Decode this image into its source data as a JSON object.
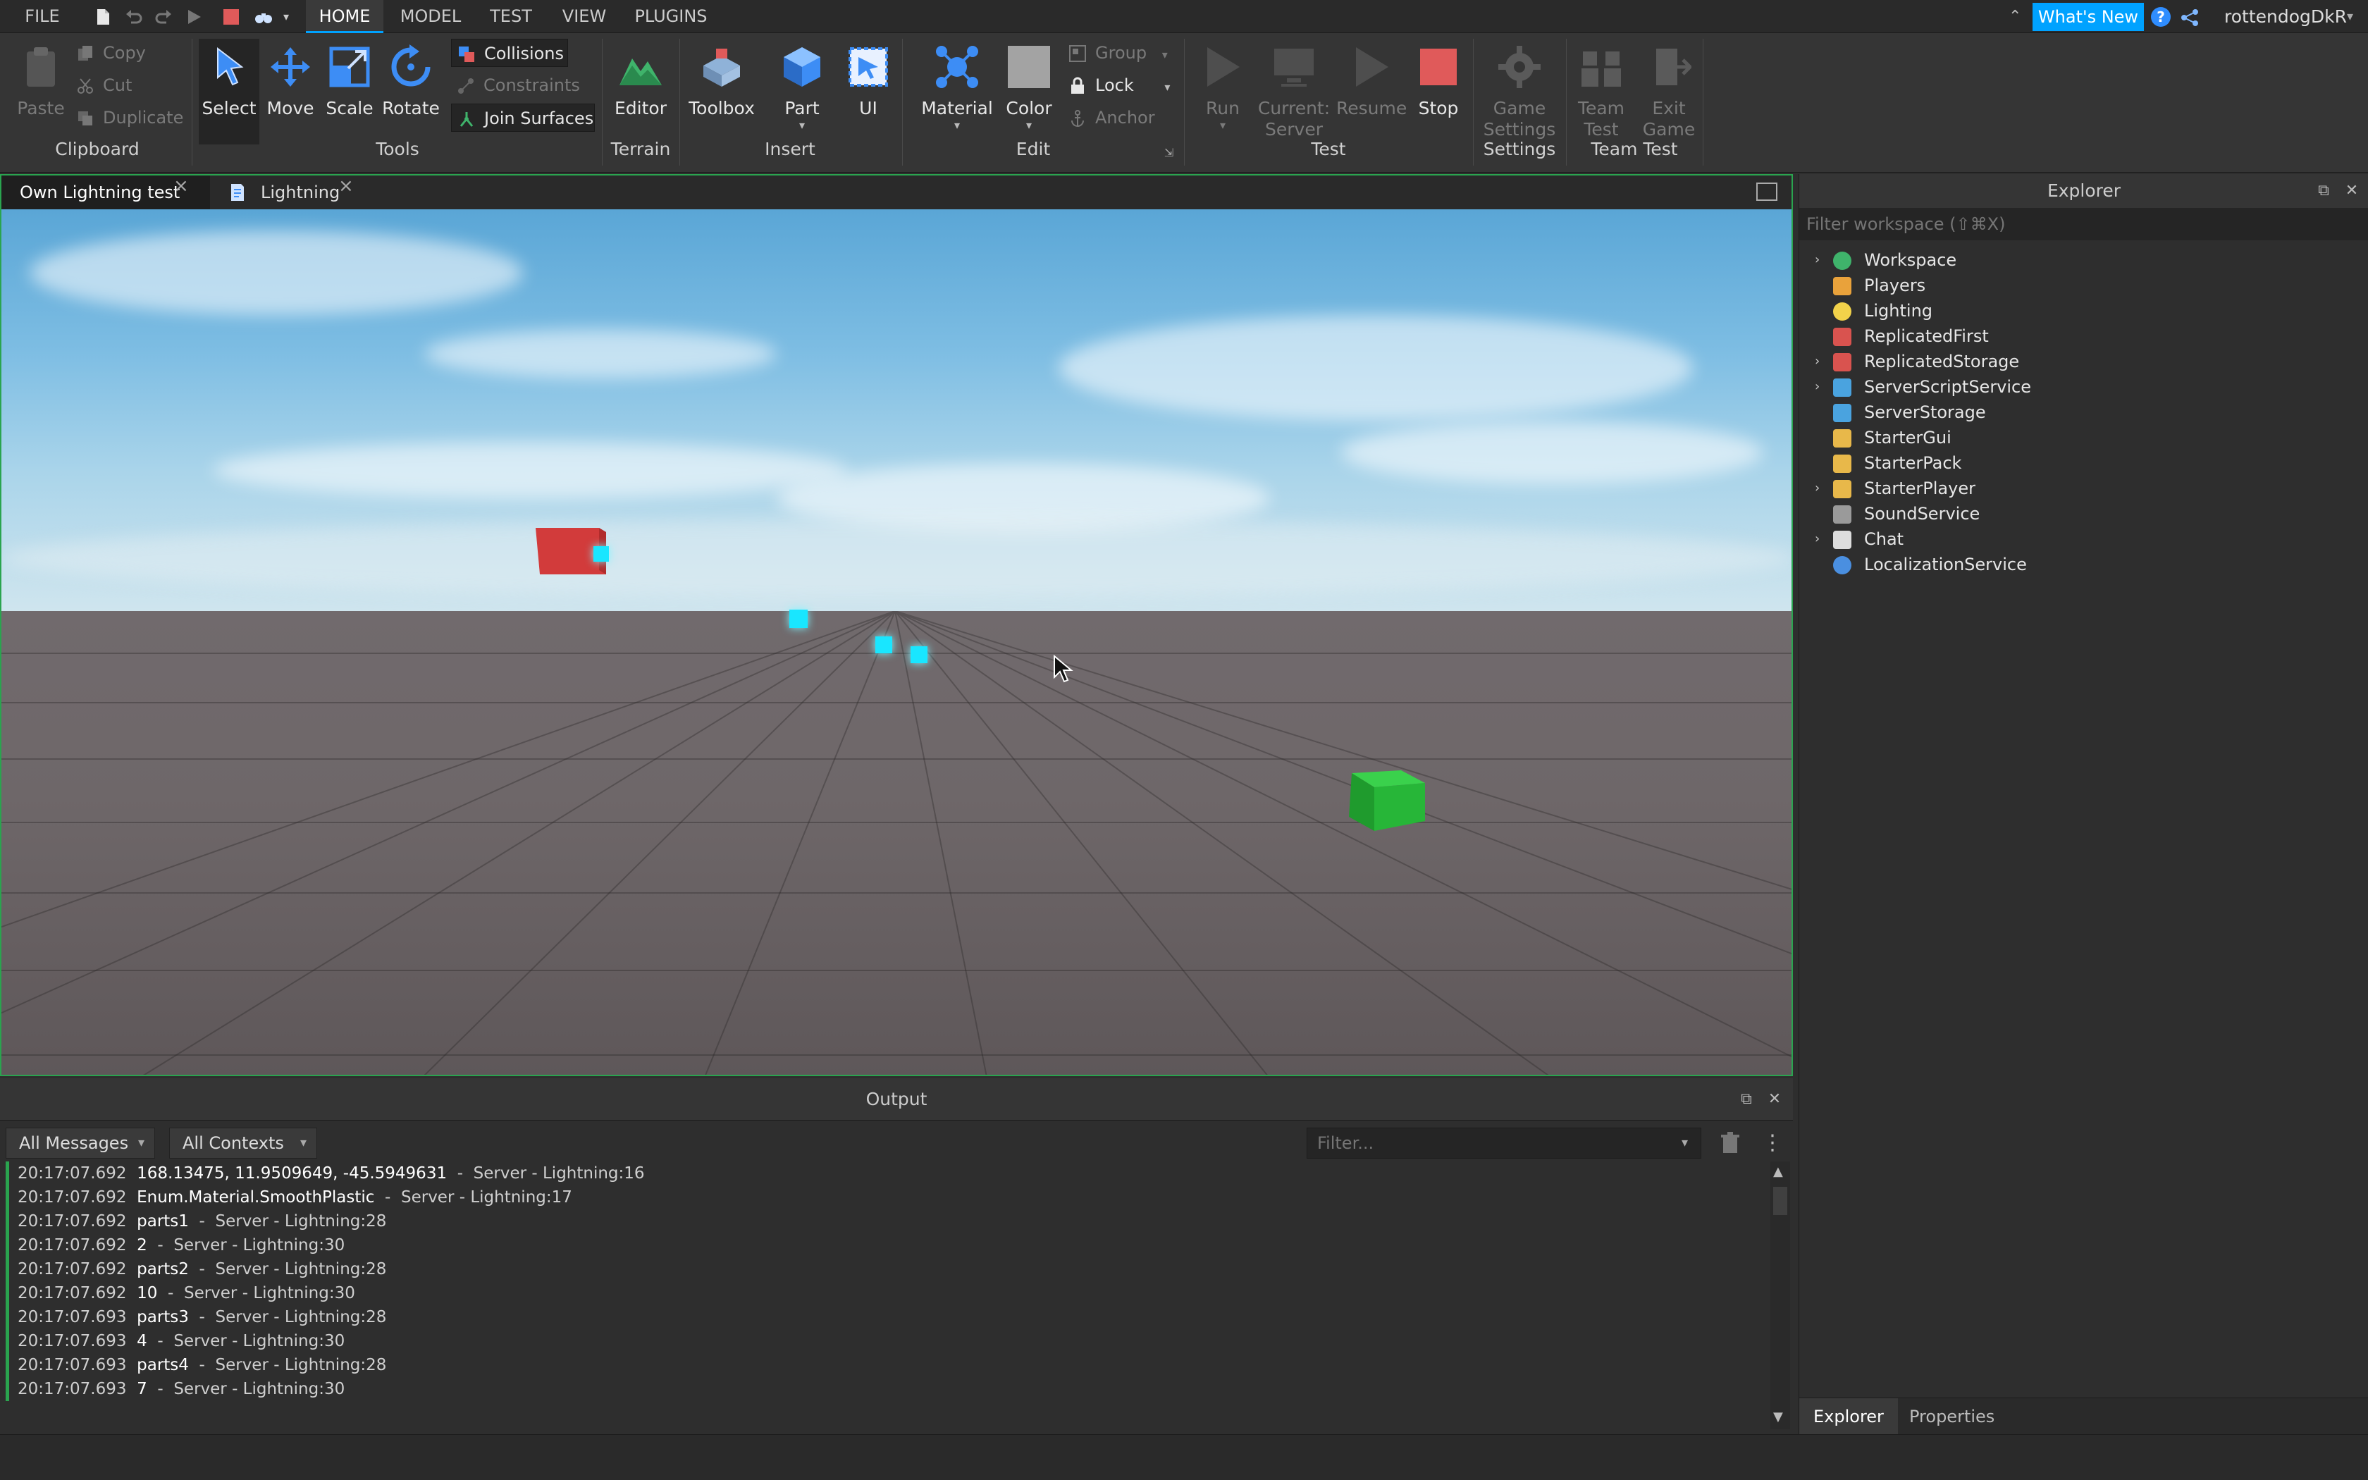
{
  "menubar": {
    "file": "FILE",
    "tabs": [
      {
        "label": "HOME",
        "active": true
      },
      {
        "label": "MODEL",
        "active": false
      },
      {
        "label": "TEST",
        "active": false
      },
      {
        "label": "VIEW",
        "active": false
      },
      {
        "label": "PLUGINS",
        "active": false
      }
    ],
    "whats_new": "What's New",
    "username": "rottendogDkR"
  },
  "ribbon": {
    "clipboard": {
      "group": "Clipboard",
      "paste": "Paste",
      "copy": "Copy",
      "cut": "Cut",
      "duplicate": "Duplicate"
    },
    "tools": {
      "group": "Tools",
      "select": "Select",
      "move": "Move",
      "scale": "Scale",
      "rotate": "Rotate",
      "collisions": "Collisions",
      "constraints": "Constraints",
      "join_surfaces": "Join Surfaces"
    },
    "terrain": {
      "group": "Terrain",
      "editor": "Editor"
    },
    "insert": {
      "group": "Insert",
      "toolbox": "Toolbox",
      "part": "Part",
      "ui": "UI"
    },
    "edit": {
      "group": "Edit",
      "material": "Material",
      "color": "Color",
      "group_btn": "Group",
      "lock": "Lock",
      "anchor": "Anchor"
    },
    "test": {
      "group": "Test",
      "run": "Run",
      "current_line1": "Current:",
      "current_line2": "Server",
      "resume": "Resume",
      "stop": "Stop"
    },
    "settings": {
      "group": "Settings",
      "line1": "Game",
      "line2": "Settings"
    },
    "team_test": {
      "group": "Team Test",
      "team_line1": "Team",
      "team_line2": "Test",
      "exit_line1": "Exit",
      "exit_line2": "Game"
    }
  },
  "doc_tabs": [
    {
      "label": "Own Lightning test",
      "active": true
    },
    {
      "label": "Lightning",
      "active": false
    }
  ],
  "output": {
    "title": "Output",
    "messages_filter": "All Messages",
    "contexts_filter": "All Contexts",
    "filter_placeholder": "Filter...",
    "lines": [
      {
        "ts": "20:17:07.692",
        "msg": "168.13475, 11.9509649, -45.5949631",
        "src": "Server - Lightning:16"
      },
      {
        "ts": "20:17:07.692",
        "msg": "Enum.Material.SmoothPlastic",
        "src": "Server - Lightning:17"
      },
      {
        "ts": "20:17:07.692",
        "msg": "parts1",
        "src": "Server - Lightning:28"
      },
      {
        "ts": "20:17:07.692",
        "msg": "2",
        "src": "Server - Lightning:30"
      },
      {
        "ts": "20:17:07.692",
        "msg": "parts2",
        "src": "Server - Lightning:28"
      },
      {
        "ts": "20:17:07.692",
        "msg": "10",
        "src": "Server - Lightning:30"
      },
      {
        "ts": "20:17:07.693",
        "msg": "parts3",
        "src": "Server - Lightning:28"
      },
      {
        "ts": "20:17:07.693",
        "msg": "4",
        "src": "Server - Lightning:30"
      },
      {
        "ts": "20:17:07.693",
        "msg": "parts4",
        "src": "Server - Lightning:28"
      },
      {
        "ts": "20:17:07.693",
        "msg": "7",
        "src": "Server - Lightning:30"
      }
    ]
  },
  "explorer": {
    "title": "Explorer",
    "filter_placeholder": "Filter workspace (⇧⌘X)",
    "items": [
      {
        "label": "Workspace",
        "expandable": true,
        "icon": "globe-icon",
        "color": "#3fb36b"
      },
      {
        "label": "Players",
        "expandable": false,
        "icon": "players-icon",
        "color": "#e9a23b"
      },
      {
        "label": "Lighting",
        "expandable": false,
        "icon": "lightbulb-icon",
        "color": "#f2d24a"
      },
      {
        "label": "ReplicatedFirst",
        "expandable": false,
        "icon": "replicated-icon",
        "color": "#d9534f"
      },
      {
        "label": "ReplicatedStorage",
        "expandable": true,
        "icon": "replicated-icon",
        "color": "#d9534f"
      },
      {
        "label": "ServerScriptService",
        "expandable": true,
        "icon": "server-script-icon",
        "color": "#4aa3df"
      },
      {
        "label": "ServerStorage",
        "expandable": false,
        "icon": "server-storage-icon",
        "color": "#4aa3df"
      },
      {
        "label": "StarterGui",
        "expandable": false,
        "icon": "folder-icon",
        "color": "#e8b84a"
      },
      {
        "label": "StarterPack",
        "expandable": false,
        "icon": "folder-icon",
        "color": "#e8b84a"
      },
      {
        "label": "StarterPlayer",
        "expandable": true,
        "icon": "folder-icon",
        "color": "#e8b84a"
      },
      {
        "label": "SoundService",
        "expandable": false,
        "icon": "speaker-icon",
        "color": "#9a9a9a"
      },
      {
        "label": "Chat",
        "expandable": true,
        "icon": "chat-icon",
        "color": "#dddddd"
      },
      {
        "label": "LocalizationService",
        "expandable": false,
        "icon": "localization-icon",
        "color": "#4a8fe0"
      }
    ],
    "tabs": [
      {
        "label": "Explorer",
        "active": true
      },
      {
        "label": "Properties",
        "active": false
      }
    ]
  }
}
